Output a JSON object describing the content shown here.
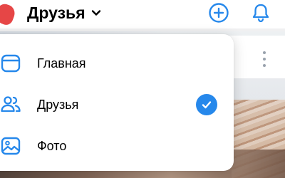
{
  "header": {
    "title": "Друзья",
    "icons": [
      "chevron-down-icon",
      "plus-circle-icon",
      "bell-icon"
    ],
    "accent": "#2688eb"
  },
  "menu": {
    "items": [
      {
        "label": "Главная",
        "icon": "home-screen-icon",
        "selected": false
      },
      {
        "label": "Друзья",
        "icon": "users-icon",
        "selected": true
      },
      {
        "label": "Фото",
        "icon": "picture-icon",
        "selected": false
      }
    ]
  },
  "colors": {
    "accent": "#2688eb",
    "logo": "#e64646",
    "icon_gray": "#99a2ad"
  }
}
